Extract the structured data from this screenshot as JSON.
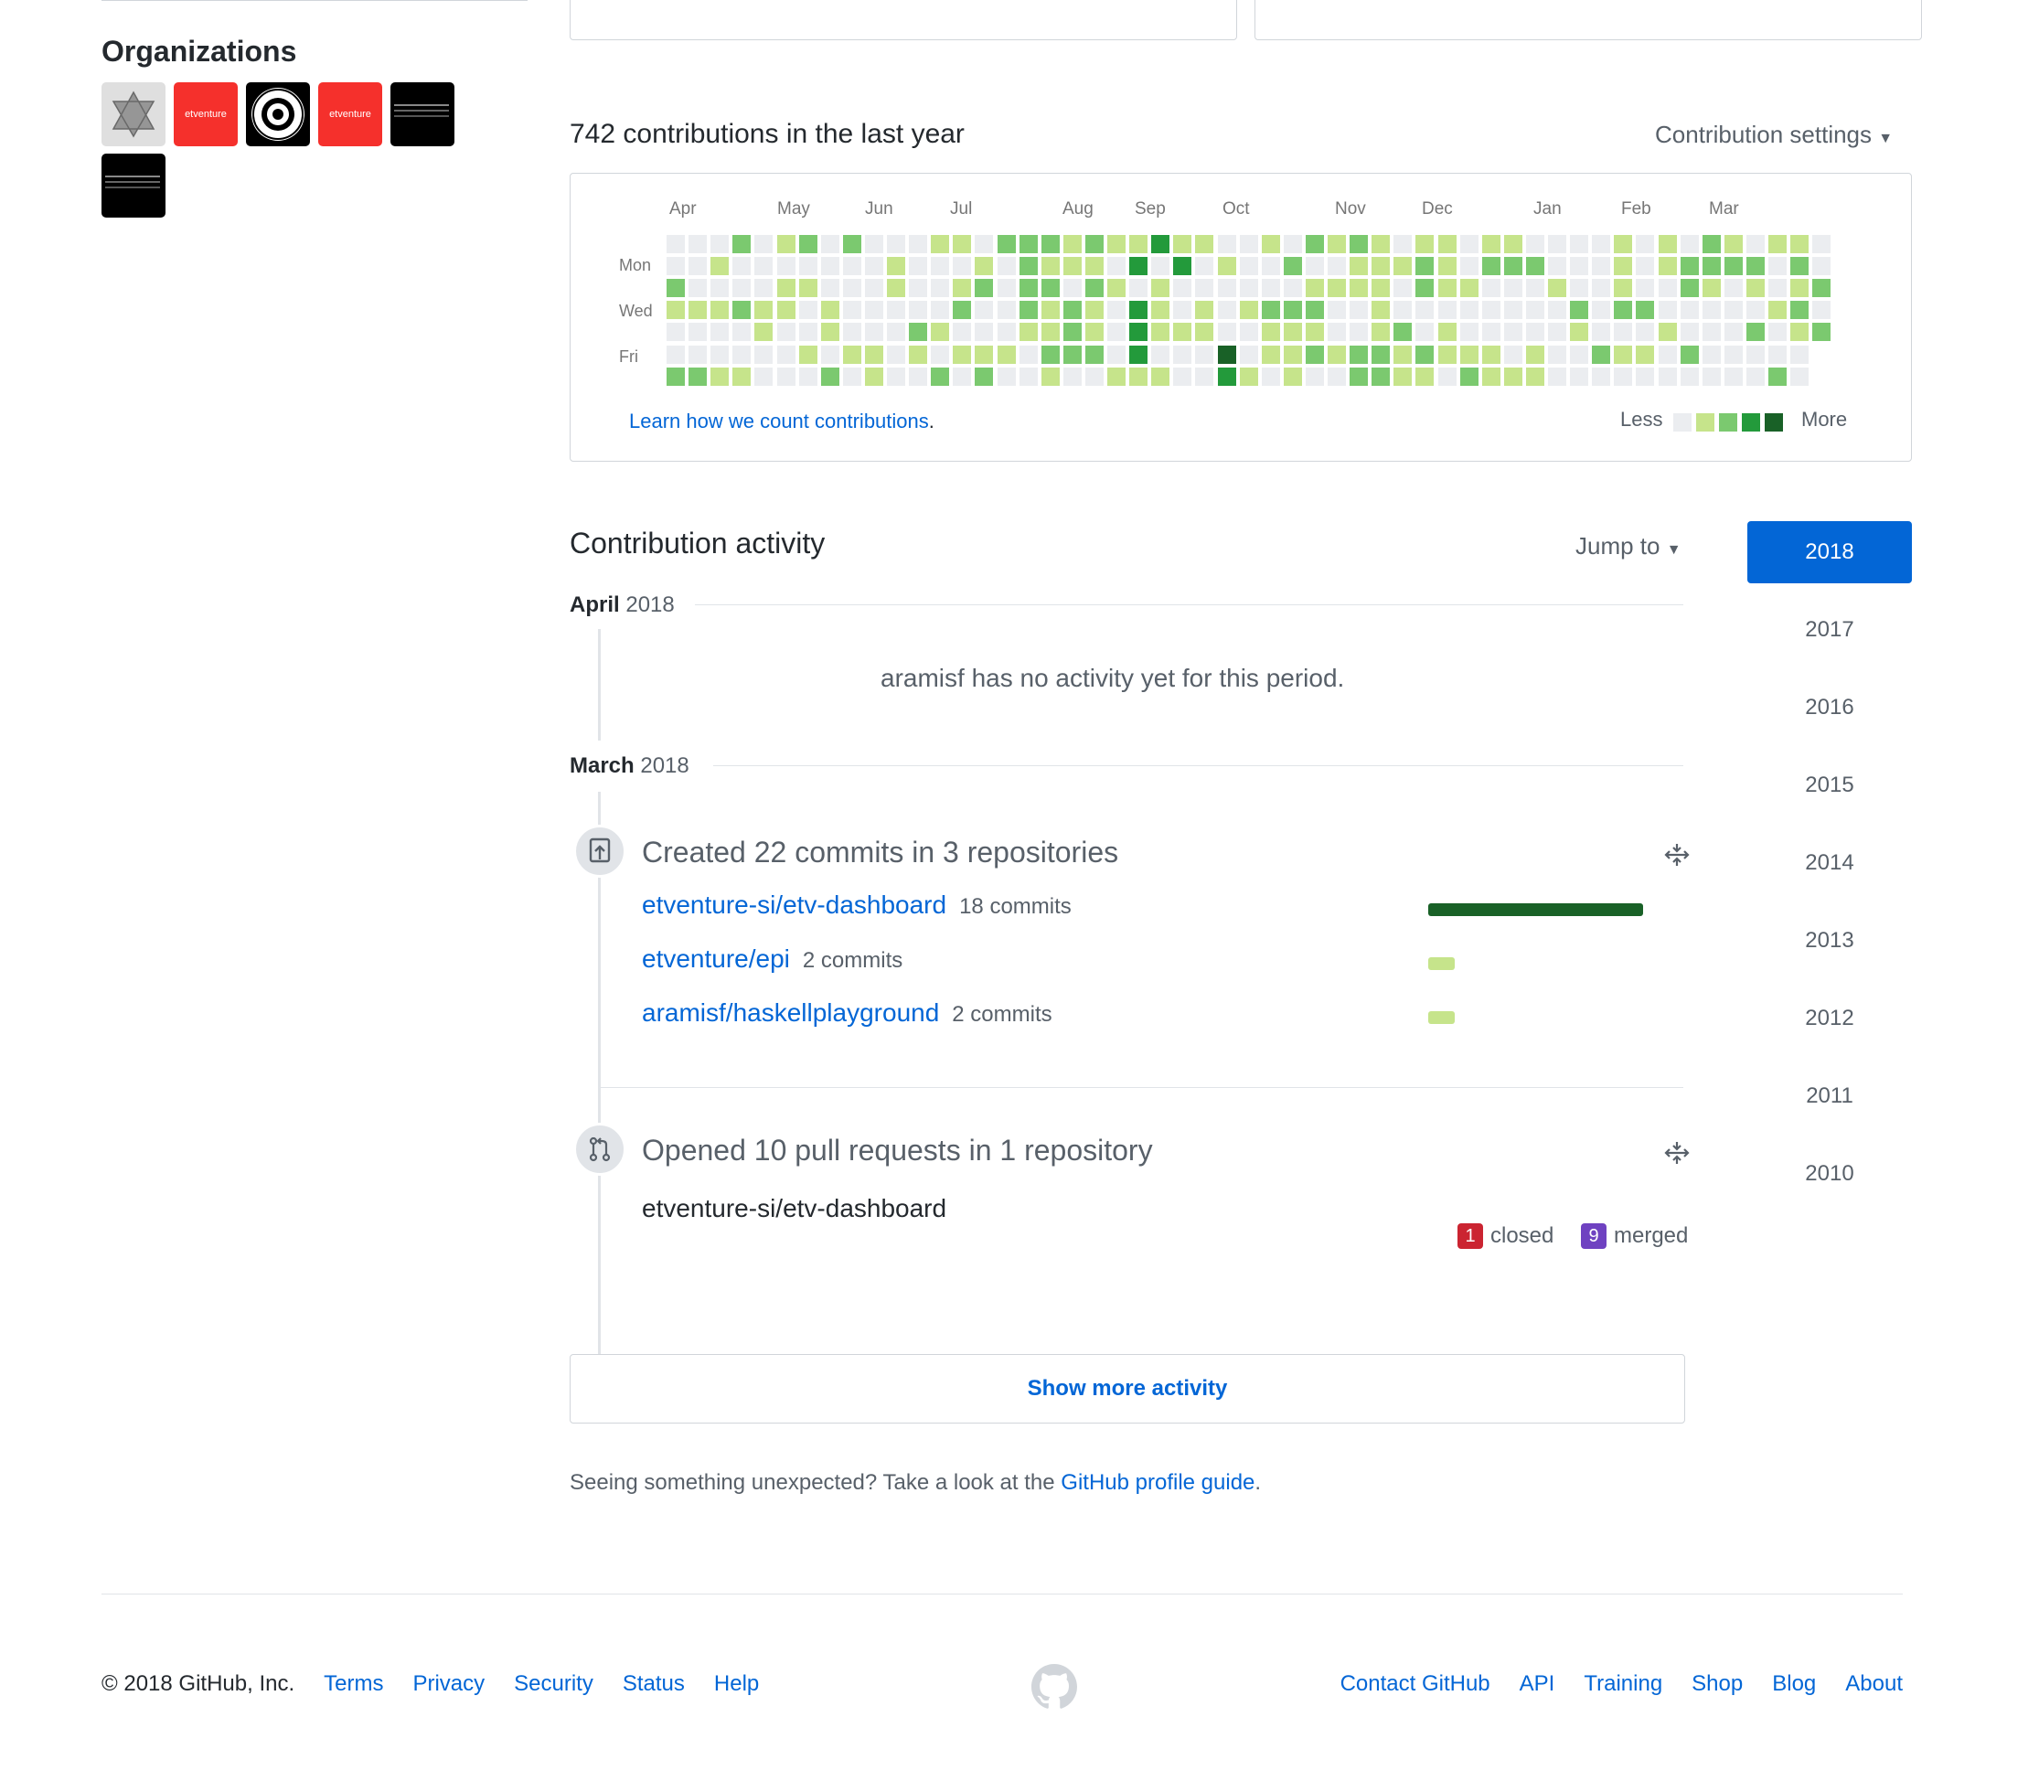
{
  "organizations": {
    "title": "Organizations",
    "items": [
      {
        "name": "star-org",
        "kind": "gray"
      },
      {
        "name": "etventure",
        "kind": "red",
        "label": "etventure"
      },
      {
        "name": "seal-org",
        "kind": "seal"
      },
      {
        "name": "etventure-2",
        "kind": "red",
        "label": "etventure"
      },
      {
        "name": "terminal-org",
        "kind": "black"
      },
      {
        "name": "terminal-org-2",
        "kind": "black"
      }
    ]
  },
  "contributions": {
    "title": "742 contributions in the last year",
    "settings_label": "Contribution settings",
    "months": [
      "Apr",
      "May",
      "Jun",
      "Jul",
      "Aug",
      "Sep",
      "Oct",
      "Nov",
      "Dec",
      "Jan",
      "Feb",
      "Mar"
    ],
    "days": [
      "Mon",
      "Wed",
      "Fri"
    ],
    "learn_link": "Learn how we count contributions",
    "learn_suffix": ".",
    "legend_less": "Less",
    "legend_more": "More",
    "colors": [
      "#ebedf0",
      "#c6e48b",
      "#7bc96f",
      "#239a3b",
      "#196127"
    ]
  },
  "activity": {
    "title": "Contribution activity",
    "jump_label": "Jump to",
    "years": [
      "2018",
      "2017",
      "2016",
      "2015",
      "2014",
      "2013",
      "2012",
      "2011",
      "2010"
    ],
    "april": {
      "month": "April",
      "year": "2018",
      "empty_text": "aramisf has no activity yet for this period."
    },
    "march": {
      "month": "March",
      "year": "2018"
    },
    "commits": {
      "summary": "Created 22 commits in 3 repositories",
      "repos": [
        {
          "name": "etventure-si/etv-dashboard",
          "count": "18 commits",
          "value": 18
        },
        {
          "name": "etventure/epi",
          "count": "2 commits",
          "value": 2
        },
        {
          "name": "aramisf/haskellplayground",
          "count": "2 commits",
          "value": 2
        }
      ]
    },
    "pulls": {
      "summary": "Opened 10 pull requests in 1 repository",
      "repo": "etventure-si/etv-dashboard",
      "closed_num": "1",
      "closed_label": "closed",
      "merged_num": "9",
      "merged_label": "merged"
    },
    "show_more": "Show more activity",
    "unexpected_prefix": "Seeing something unexpected? Take a look at the ",
    "unexpected_link": "GitHub profile guide",
    "unexpected_suffix": "."
  },
  "footer": {
    "copyright": "© 2018 GitHub, Inc.",
    "left_links": [
      "Terms",
      "Privacy",
      "Security",
      "Status",
      "Help"
    ],
    "right_links": [
      "Contact GitHub",
      "API",
      "Training",
      "Shop",
      "Blog",
      "About"
    ]
  }
}
